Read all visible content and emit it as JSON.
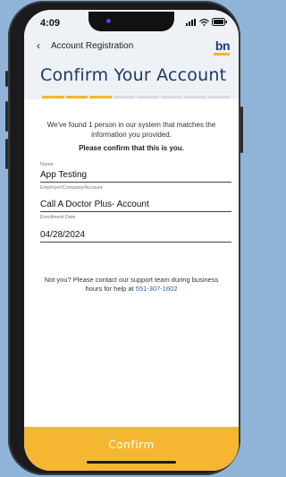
{
  "status": {
    "time": "4:09"
  },
  "nav": {
    "back_label": "Account Registration",
    "logo_text": "bn"
  },
  "page": {
    "title": "Confirm Your Account"
  },
  "progress": {
    "completed_steps": 3,
    "total_steps": 8
  },
  "intro": {
    "message": "We've found 1 person in our system that matches the information you provided.",
    "question": "Please confirm that this is you."
  },
  "fields": [
    {
      "label": "Name",
      "value": "App Testing"
    },
    {
      "label": "Employer/Company/Account",
      "value": "Call A Doctor Plus- Account"
    },
    {
      "label": "Enrollment Date",
      "value": "04/28/2024"
    }
  ],
  "support": {
    "text": "Not you? Please contact our support team during business hours for help at",
    "phone": "551-307-1602"
  },
  "footer": {
    "confirm_label": "Confirm"
  },
  "colors": {
    "accent": "#f5b731",
    "title": "#1f3a63",
    "link": "#2a5db0",
    "background": "#8fb4d8"
  }
}
